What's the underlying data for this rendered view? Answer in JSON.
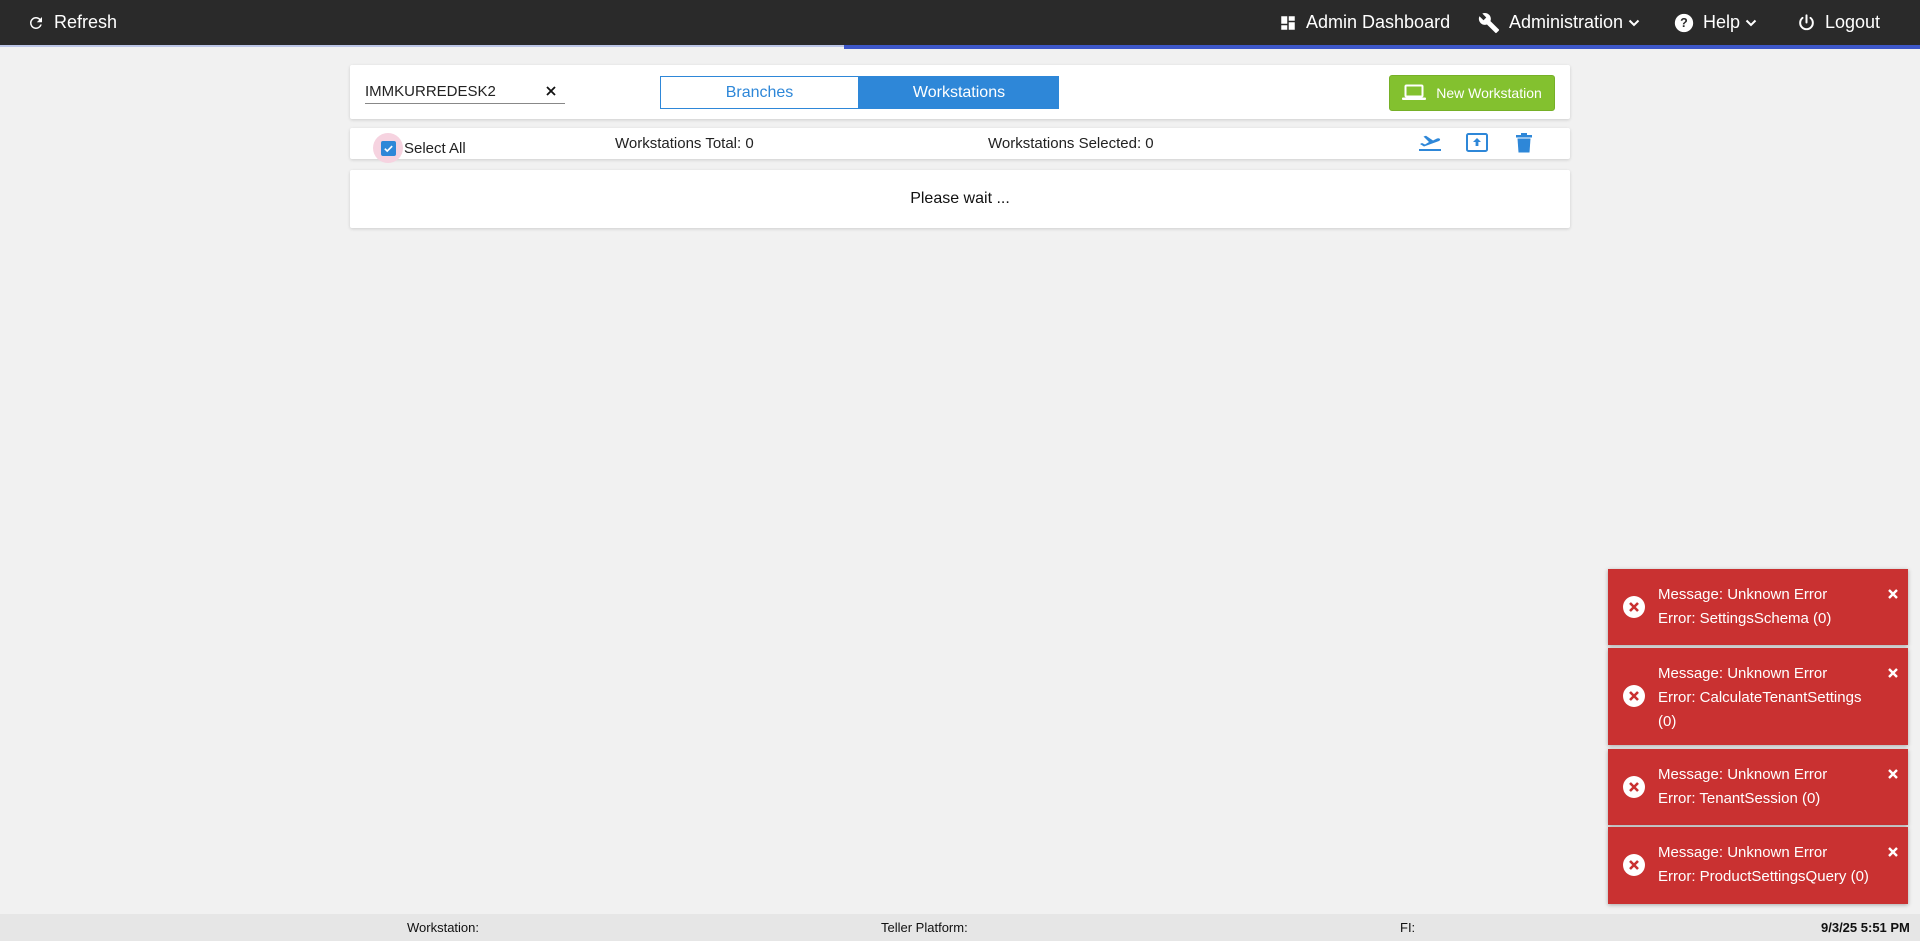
{
  "topbar": {
    "refresh_label": "Refresh",
    "admin_dashboard_label": "Admin Dashboard",
    "administration_label": "Administration",
    "help_label": "Help",
    "logout_label": "Logout"
  },
  "search": {
    "value": "IMMKURREDESK2"
  },
  "tabs": {
    "branches_label": "Branches",
    "workstations_label": "Workstations",
    "active": "Workstations"
  },
  "new_workstation_label": "New Workstation",
  "summary": {
    "select_all_label": "Select All",
    "select_all_checked": true,
    "total_label": "Workstations Total: 0",
    "selected_label": "Workstations Selected: 0"
  },
  "status_message": "Please wait ...",
  "toasts": [
    {
      "line1": "Message: Unknown Error",
      "line2": "Error: SettingsSchema (0)"
    },
    {
      "line1": "Message: Unknown Error",
      "line2": "Error: CalculateTenantSettings (0)"
    },
    {
      "line1": "Message: Unknown Error",
      "line2": "Error: TenantSession (0)"
    },
    {
      "line1": "Message: Unknown Error",
      "line2": "Error: ProductSettingsQuery (0)"
    }
  ],
  "footer": {
    "workstation_label": "Workstation:",
    "teller_platform_label": "Teller Platform:",
    "fi_label": "FI:",
    "datetime": "9/3/25 5:51 PM"
  },
  "colors": {
    "topbar_bg": "#2a2a2a",
    "accent_blue": "#2e87d8",
    "success_green": "#83c12f",
    "error_red": "#c93131"
  },
  "icons": [
    "refresh-icon",
    "dashboard-icon",
    "wrench-icon",
    "chevron-down-icon",
    "help-icon",
    "power-icon",
    "close-icon",
    "laptop-icon",
    "checkmark-icon",
    "airplane-departure-icon",
    "upload-box-icon",
    "trash-icon",
    "error-circle-icon"
  ]
}
